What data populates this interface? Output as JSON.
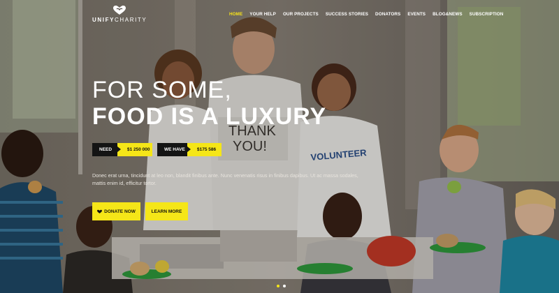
{
  "brand": {
    "logo_bold": "UNIFY",
    "logo_thin": "CHARITY",
    "accent_color": "#f5e618"
  },
  "nav": {
    "items": [
      {
        "label": "HOME",
        "active": true
      },
      {
        "label": "YOUR HELP",
        "active": false
      },
      {
        "label": "OUR PROJECTS",
        "active": false
      },
      {
        "label": "SUCCESS STORIES",
        "active": false
      },
      {
        "label": "DONATORS",
        "active": false
      },
      {
        "label": "EVENTS",
        "active": false
      },
      {
        "label": "BLOG&NEWS",
        "active": false
      },
      {
        "label": "SUBSCRIPTION",
        "active": false
      }
    ]
  },
  "hero": {
    "headline_line1": "FOR SOME,",
    "headline_line2": "FOOD IS A LUXURY",
    "need_label": "NEED",
    "need_value": "$1 250 000",
    "have_label": "WE HAVE",
    "have_value": "$175 586",
    "description": "Donec erat urna, tincidunt at leo non, blandit finibus ante. Nunc venenatis risus in finibus dapibus. Ut ac massa sodales, mattis enim id, efficitur tortor.",
    "donate_label": "DONATE NOW",
    "learn_label": "LEARN MORE",
    "photo_sign_line1": "THANK",
    "photo_sign_line2": "YOU!",
    "photo_shirt_text": "VOLUNTEER"
  },
  "slider": {
    "dot_count": 2,
    "active_index": 0
  }
}
